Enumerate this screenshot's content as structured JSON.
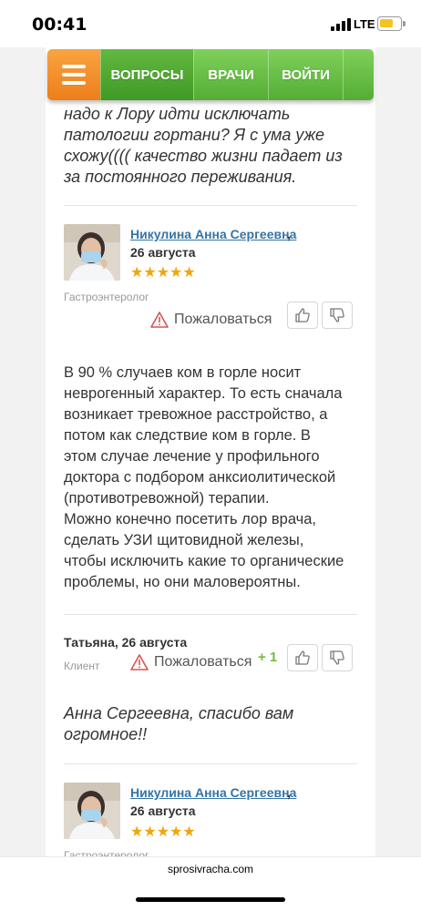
{
  "status_bar": {
    "time": "00:41",
    "network": "LTE",
    "battery_level": 0.5,
    "battery_color": "#f3c425"
  },
  "nav": {
    "menu_icon": "hamburger-icon",
    "items": [
      "ВОПРОСЫ",
      "ВРАЧИ",
      "ВОЙТИ"
    ],
    "active_index": 0,
    "accent_orange": "#f08a28",
    "accent_green": "#5fb83b"
  },
  "question_tail": {
    "lines": [
      "надо к Лору идти исключать",
      "патологии гортани? Я с ума уже",
      "схожу(((( качество жизни падает из",
      "за постоянного переживания."
    ]
  },
  "answer1": {
    "doctor_name": "Никулина Анна Сергеевна",
    "comma": ",",
    "date": "26 августа",
    "rating": "★★★★★",
    "rating_value": 5,
    "specialty": "Гастроэнтеролог",
    "complain_label": "Пожаловаться",
    "paragraphs": [
      [
        "В 90 % случаев ком в горле носит",
        "неврогенный характер. То есть сначала",
        "возникает тревожное расстройство, а",
        "потом как следствие ком в горле. В",
        "этом случае лечение у профильного",
        "доктора с подбором анксиолитической",
        "(противотревожной) терапии."
      ],
      [
        "Можно конечно посетить лор врача,",
        "сделать УЗИ щитовидной железы,",
        "чтобы исключить какие то органические",
        "проблемы, но они маловероятны."
      ]
    ]
  },
  "client_reply": {
    "author": "Татьяна, 26 августа",
    "role": "Клиент",
    "complain_label": "Пожаловаться",
    "votes": "+ 1",
    "lines": [
      "Анна Сергеевна, спасибо вам",
      "огромное!!"
    ]
  },
  "answer2": {
    "doctor_name": "Никулина Анна Сергеевна",
    "comma": ",",
    "date": "26 августа",
    "rating": "★★★★★",
    "rating_value": 5,
    "specialty": "Гастроэнтеролог"
  },
  "browser": {
    "domain": "sprosivracha.com"
  }
}
